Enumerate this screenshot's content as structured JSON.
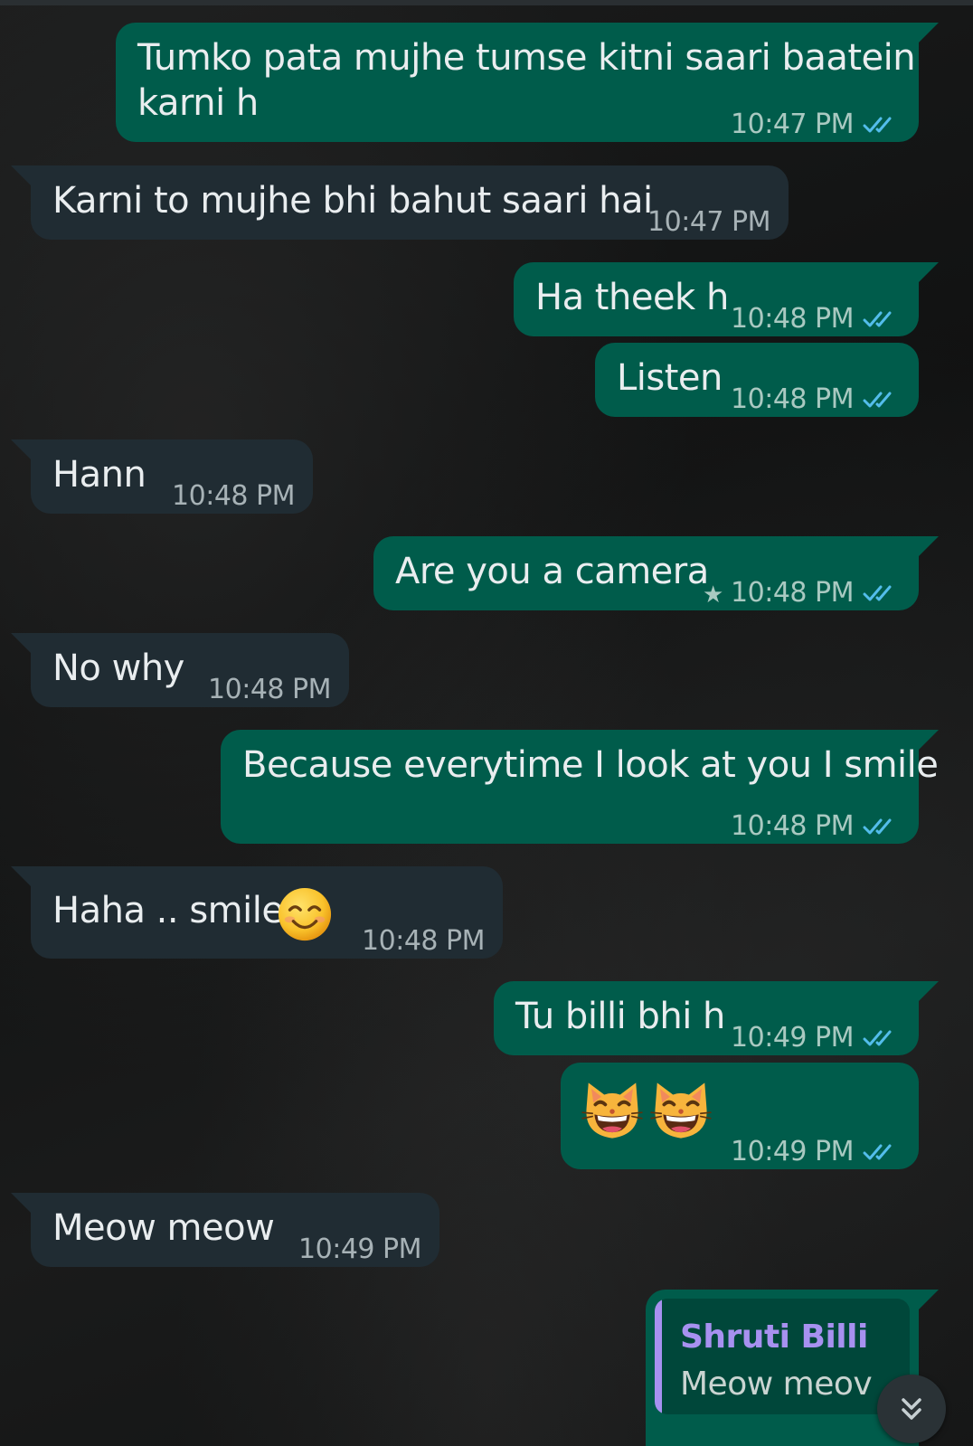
{
  "messages": [
    {
      "dir": "out",
      "text1": "Tumko pata mujhe tumse kitni saari baatein",
      "text2": "karni h",
      "time": "10:47 PM"
    },
    {
      "dir": "in",
      "text": "Karni to mujhe bhi bahut saari hai",
      "time": "10:47 PM"
    },
    {
      "dir": "out",
      "text": "Ha theek h",
      "time": "10:48 PM"
    },
    {
      "dir": "out",
      "text": "Listen",
      "time": "10:48 PM"
    },
    {
      "dir": "in",
      "text": "Hann",
      "time": "10:48 PM"
    },
    {
      "dir": "out",
      "text": "Are you a camera",
      "time": "10:48 PM",
      "starred": true
    },
    {
      "dir": "in",
      "text": "No why",
      "time": "10:48 PM"
    },
    {
      "dir": "out",
      "text": "Because everytime I look at you I smile",
      "time": "10:48 PM"
    },
    {
      "dir": "in",
      "text": "Haha .. smile",
      "time": "10:48 PM",
      "emoji": "smiling-face-icon"
    },
    {
      "dir": "out",
      "text": "Tu billi bhi h",
      "time": "10:49 PM"
    },
    {
      "dir": "out",
      "emoji": "grinning-cat-icon x2",
      "time": "10:49 PM"
    },
    {
      "dir": "in",
      "text": "Meow meow",
      "time": "10:49 PM"
    },
    {
      "dir": "out",
      "reply_name": "Shruti Billi",
      "reply_text": "Meow meov"
    }
  ],
  "colors": {
    "outgoing_bubble": "#005c4b",
    "incoming_bubble": "#202c33",
    "read_ticks": "#53bdeb",
    "reply_accent": "#a791f0"
  },
  "icons": {
    "read_receipt": "double-check-icon",
    "star": "star-icon",
    "scroll_down": "double-chevron-down-icon"
  }
}
